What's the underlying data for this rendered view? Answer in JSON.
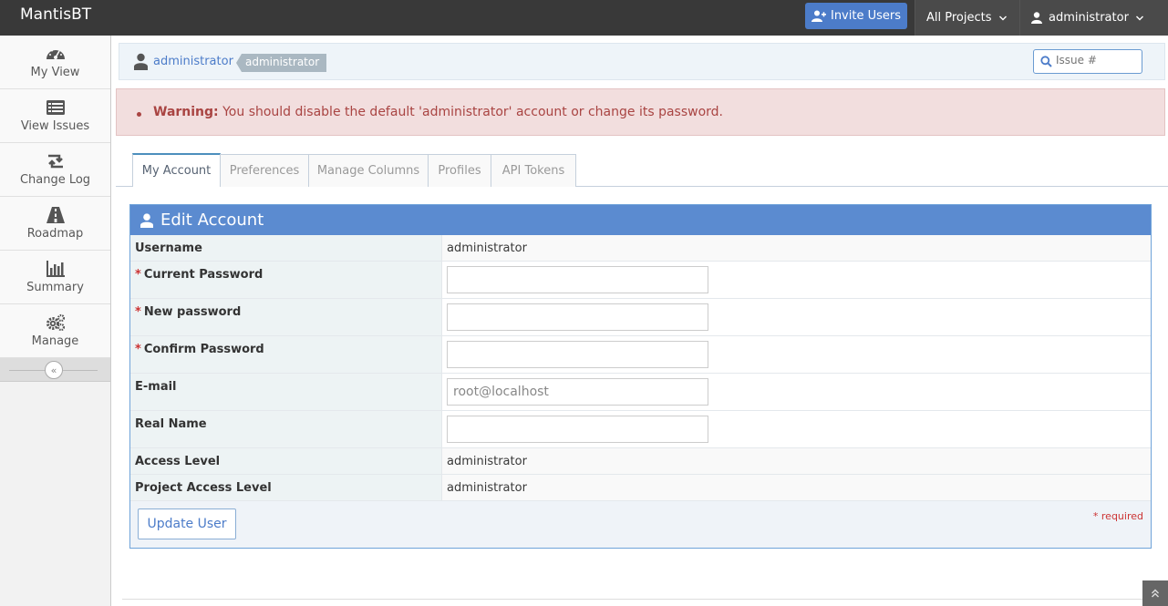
{
  "app": {
    "brand": "MantisBT"
  },
  "navbar": {
    "invite_label": "Invite Users",
    "project_label": "All Projects",
    "user_label": "administrator"
  },
  "sidebar": {
    "items": [
      {
        "label": "My View",
        "icon": "dashboard-icon"
      },
      {
        "label": "View Issues",
        "icon": "list-icon"
      },
      {
        "label": "Change Log",
        "icon": "retweet-icon"
      },
      {
        "label": "Roadmap",
        "icon": "road-icon"
      },
      {
        "label": "Summary",
        "icon": "bar-chart-icon"
      },
      {
        "label": "Manage",
        "icon": "gears-icon"
      }
    ],
    "collapse_glyph": "«"
  },
  "breadcrumb": {
    "user_link": "administrator",
    "access_tag": "administrator"
  },
  "search": {
    "placeholder": "Issue #"
  },
  "alert": {
    "label": "Warning:",
    "message": " You should disable the default 'administrator' account or change its password."
  },
  "tabs": [
    {
      "label": "My Account",
      "active": true
    },
    {
      "label": "Preferences"
    },
    {
      "label": "Manage Columns"
    },
    {
      "label": "Profiles"
    },
    {
      "label": "API Tokens"
    }
  ],
  "form": {
    "title": "Edit Account",
    "required_mark": "*",
    "rows": {
      "username": {
        "label": "Username",
        "value": "administrator"
      },
      "current_password": {
        "label": "Current Password",
        "value": ""
      },
      "new_password": {
        "label": "New password",
        "value": ""
      },
      "confirm_password": {
        "label": "Confirm Password",
        "value": ""
      },
      "email": {
        "label": "E-mail",
        "value": "root@localhost"
      },
      "real_name": {
        "label": "Real Name",
        "value": ""
      },
      "access_level": {
        "label": "Access Level",
        "value": "administrator"
      },
      "project_access_level": {
        "label": "Project Access Level",
        "value": "administrator"
      }
    },
    "submit_label": "Update User",
    "required_note": "* required"
  },
  "colors": {
    "navbar": "#393939",
    "accent": "#4c7cc9",
    "widget_header": "#5b8bd0",
    "alert_text": "#a94442"
  }
}
